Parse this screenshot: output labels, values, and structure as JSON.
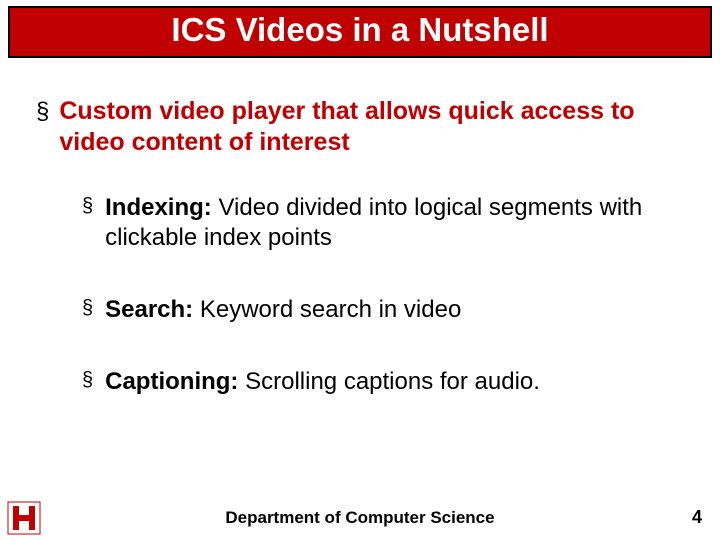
{
  "title": "ICS Videos in a Nutshell",
  "main_bullet": "Custom video player that allows quick access to video content of interest",
  "subs": [
    {
      "label": "Indexing:",
      "text": " Video divided into logical segments with clickable index points"
    },
    {
      "label": "Search:",
      "text": " Keyword search in video"
    },
    {
      "label": "Captioning:",
      "text": " Scrolling captions for audio."
    }
  ],
  "footer": {
    "department": "Department of Computer Science",
    "page_number": "4"
  },
  "bullet_glyph": "§",
  "colors": {
    "accent": "#c00000"
  }
}
